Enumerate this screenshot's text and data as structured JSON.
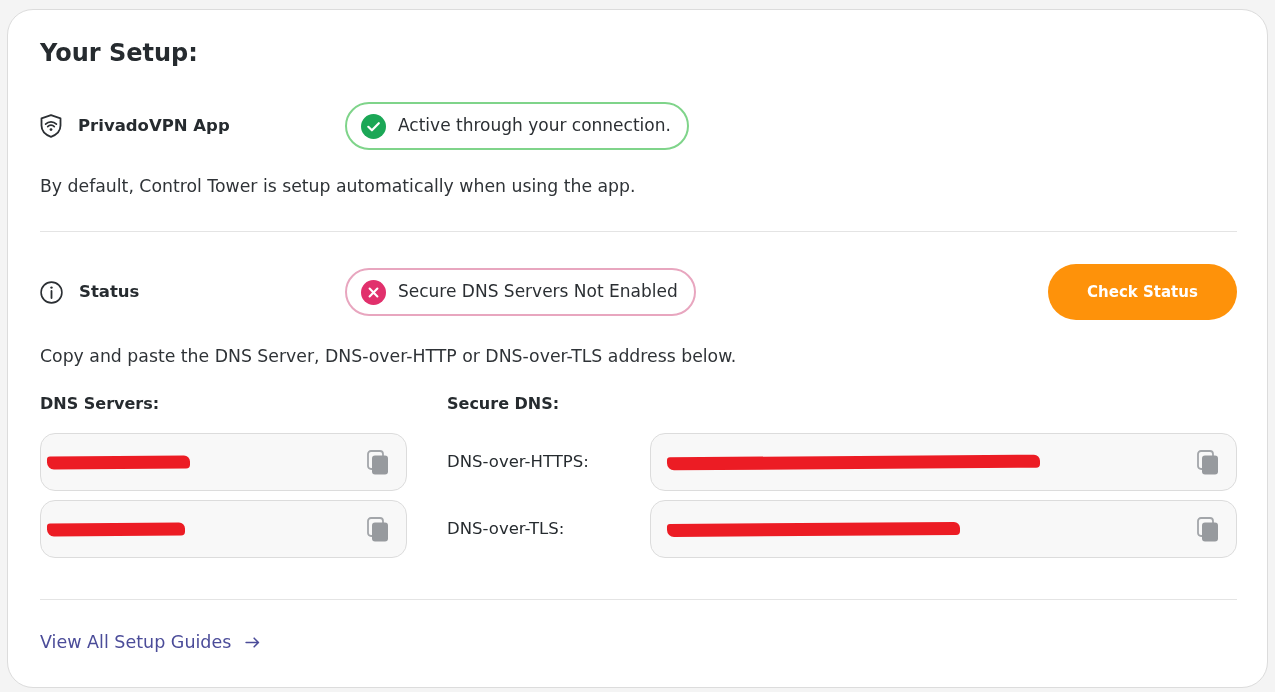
{
  "title": "Your Setup:",
  "app_row": {
    "label": "PrivadoVPN App",
    "status": {
      "kind": "ok",
      "text": "Active through your connection."
    }
  },
  "app_note": "By default, Control Tower is setup automatically when using the app.",
  "status_row": {
    "label": "Status",
    "status": {
      "kind": "error",
      "text": "Secure DNS Servers Not Enabled"
    },
    "button": "Check Status"
  },
  "instructions": "Copy and paste the DNS Server, DNS-over-HTTP or DNS-over-TLS address below.",
  "dns_servers": {
    "heading": "DNS Servers:",
    "fields": [
      {
        "redacted": true
      },
      {
        "redacted": true
      }
    ]
  },
  "secure_dns": {
    "heading": "Secure DNS:",
    "fields": [
      {
        "label": "DNS-over-HTTPS:",
        "redacted": true
      },
      {
        "label": "DNS-over-TLS:",
        "redacted": true
      }
    ]
  },
  "footer_link": "View All Setup Guides"
}
